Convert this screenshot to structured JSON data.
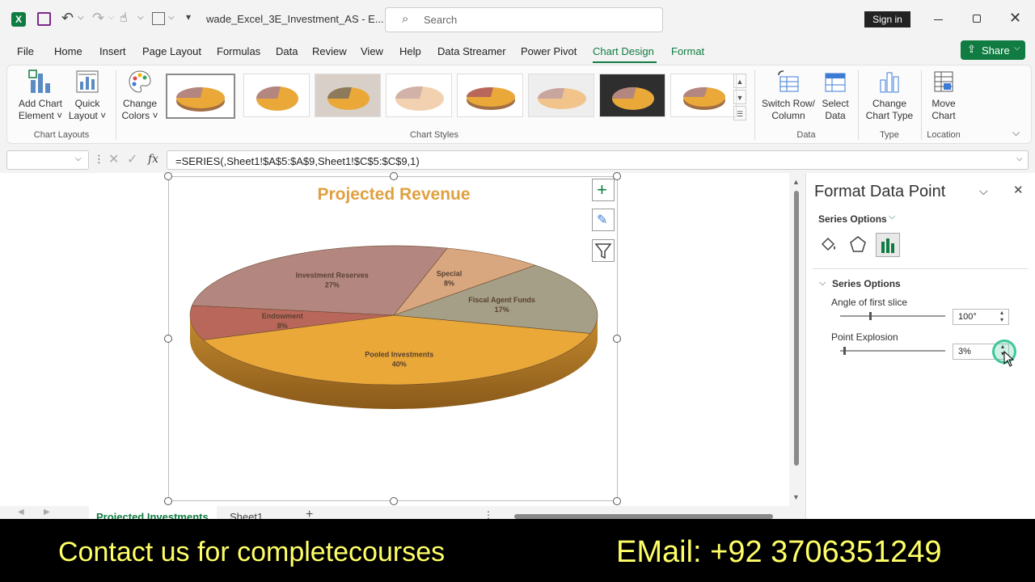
{
  "window": {
    "file_title": "wade_Excel_3E_Investment_AS  -  E...",
    "search_placeholder": "Search",
    "signin_label": "Sign in"
  },
  "ribbon_tabs": [
    "File",
    "Home",
    "Insert",
    "Page Layout",
    "Formulas",
    "Data",
    "Review",
    "View",
    "Help",
    "Data Streamer",
    "Power Pivot",
    "Chart Design",
    "Format"
  ],
  "active_tab": "Chart Design",
  "share_label": "Share",
  "ribbon": {
    "add_chart_element": [
      "Add Chart",
      "Element ˅"
    ],
    "quick_layout": [
      "Quick",
      "Layout ˅"
    ],
    "chart_layouts_group": "Chart Layouts",
    "change_colors": [
      "Change",
      "Colors ˅"
    ],
    "chart_styles_group": "Chart Styles",
    "switch_row_column": [
      "Switch Row/",
      "Column"
    ],
    "select_data": [
      "Select",
      "Data"
    ],
    "data_group": "Data",
    "change_chart_type": [
      "Change",
      "Chart Type"
    ],
    "type_group": "Type",
    "move_chart": [
      "Move",
      "Chart"
    ],
    "location_group": "Location"
  },
  "formula_bar": {
    "name_box": "",
    "fx_label": "fx",
    "formula": "=SERIES(,Sheet1!$A$5:$A$9,Sheet1!$C$5:$C$9,1)"
  },
  "chart_data": {
    "type": "pie",
    "title": "Projected Revenue",
    "slices": [
      {
        "label": "Investment Reserves",
        "pct": "27%",
        "value": 27,
        "color": "#b38780"
      },
      {
        "label": "Special",
        "pct": "8%",
        "value": 8,
        "color": "#d8a77f"
      },
      {
        "label": "Fiscal Agent Funds",
        "pct": "17%",
        "value": 17,
        "color": "#a49f86"
      },
      {
        "label": "Pooled Investments",
        "pct": "40%",
        "value": 40,
        "color": "#e9a838"
      },
      {
        "label": "Endowment",
        "pct": "8%",
        "value": 8,
        "color": "#b8675a"
      }
    ]
  },
  "pane": {
    "title": "Format Data Point",
    "series_options_menu": "Series Options",
    "section_title": "Series Options",
    "angle_label": "Angle of first slice",
    "angle_value": "100°",
    "angle_fraction": 0.28,
    "explosion_label": "Point Explosion",
    "explosion_value": "3%",
    "explosion_fraction": 0.03
  },
  "sheet_tabs": [
    "Projected Investments",
    "Sheet1"
  ],
  "footer": {
    "left_text": "Contact us for completecourses",
    "right_text": "EMail: +92 3706351249"
  },
  "colors": {
    "accent_green": "#107c41",
    "footer_text": "#ffff66"
  }
}
